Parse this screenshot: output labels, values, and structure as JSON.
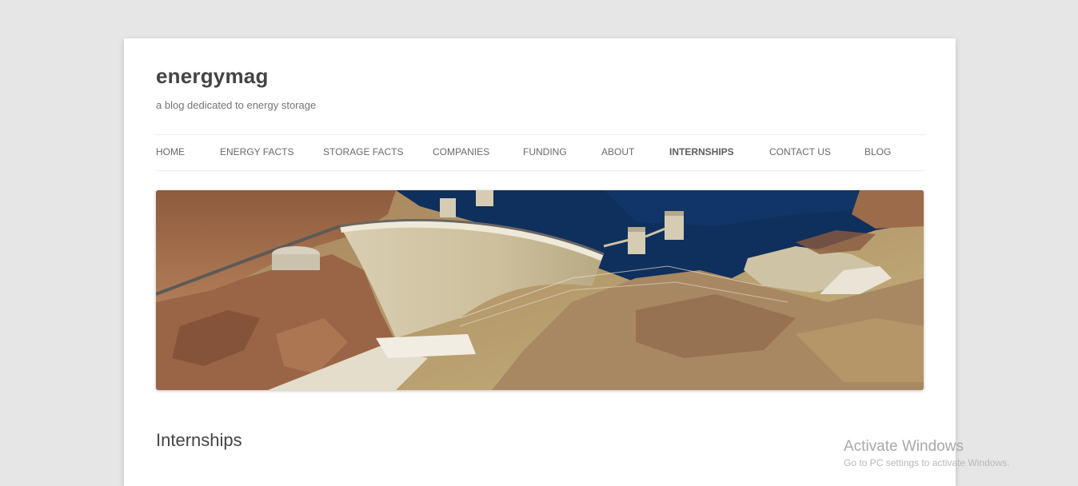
{
  "site": {
    "title": "energymag",
    "description": "a blog dedicated to energy storage"
  },
  "nav": {
    "items": [
      {
        "label": "HOME"
      },
      {
        "label": "ENERGY FACTS"
      },
      {
        "label": "STORAGE FACTS"
      },
      {
        "label": "COMPANIES"
      },
      {
        "label": "FUNDING"
      },
      {
        "label": "ABOUT"
      },
      {
        "label": "INTERNSHIPS"
      },
      {
        "label": "CONTACT US"
      },
      {
        "label": "BLOG"
      }
    ],
    "current": "INTERNSHIPS"
  },
  "header_image": {
    "subject": "aerial view of a dam with reservoir and canyon"
  },
  "entry": {
    "title": "Internships"
  },
  "os_overlay": {
    "watermark": "Activate Windows",
    "watermark_sub": "Go to PC settings to activate Windows."
  },
  "colors": {
    "background": "#e6e6e6",
    "page": "#ffffff",
    "title_text": "#444444",
    "nav_text": "#6a6a6a",
    "water": "#0f2f5c",
    "rock": "#9a6a48"
  }
}
